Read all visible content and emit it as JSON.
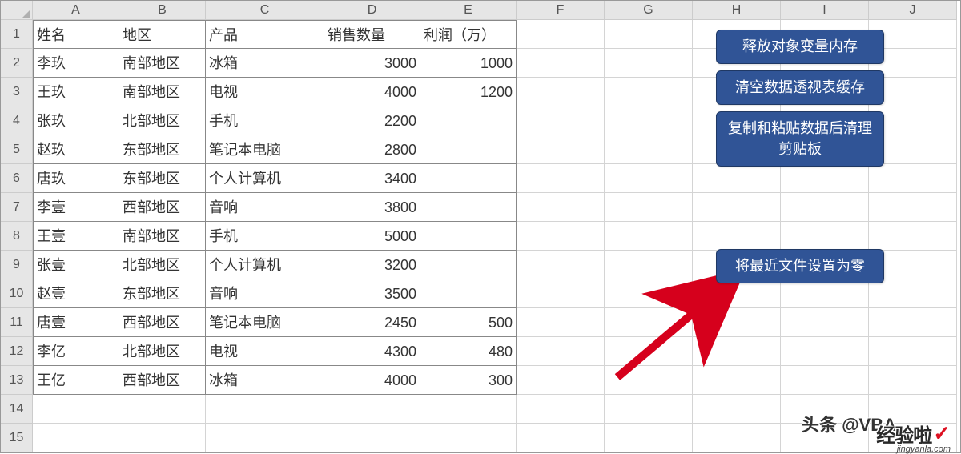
{
  "column_headers": [
    "A",
    "B",
    "C",
    "D",
    "E",
    "F",
    "G",
    "H",
    "I",
    "J"
  ],
  "table": {
    "header": [
      "姓名",
      "地区",
      "产品",
      "销售数量",
      "利润（万）"
    ],
    "rows": [
      [
        "李玖",
        "南部地区",
        "冰箱",
        "3000",
        "1000"
      ],
      [
        "王玖",
        "南部地区",
        "电视",
        "4000",
        "1200"
      ],
      [
        "张玖",
        "北部地区",
        "手机",
        "2200",
        ""
      ],
      [
        "赵玖",
        "东部地区",
        "笔记本电脑",
        "2800",
        ""
      ],
      [
        "唐玖",
        "东部地区",
        "个人计算机",
        "3400",
        ""
      ],
      [
        "李壹",
        "西部地区",
        "音响",
        "3800",
        ""
      ],
      [
        "王壹",
        "南部地区",
        "手机",
        "5000",
        ""
      ],
      [
        "张壹",
        "北部地区",
        "个人计算机",
        "3200",
        ""
      ],
      [
        "赵壹",
        "东部地区",
        "音响",
        "3500",
        ""
      ],
      [
        "唐壹",
        "西部地区",
        "笔记本电脑",
        "2450",
        "500"
      ],
      [
        "李亿",
        "北部地区",
        "电视",
        "4300",
        "480"
      ],
      [
        "王亿",
        "西部地区",
        "冰箱",
        "4000",
        "300"
      ]
    ]
  },
  "buttons": {
    "b1": "释放对象变量内存",
    "b2": "清空数据透视表缓存",
    "b3": "复制和粘贴数据后清理剪贴板",
    "b4": "将最近文件设置为零"
  },
  "watermark": {
    "text1": "头条 @VBA",
    "text2": "经验啦",
    "url": "jingyanla.com"
  },
  "total_rows": 15
}
